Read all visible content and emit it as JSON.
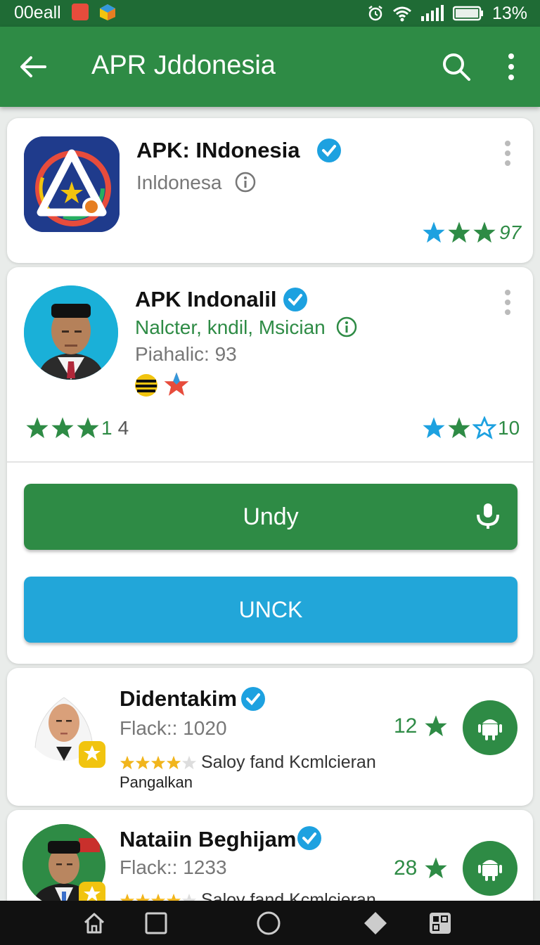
{
  "status_bar": {
    "carrier": "00eall",
    "battery": "13%",
    "icons": [
      "notification-icon",
      "app-icon",
      "alarm-icon",
      "wifi-icon",
      "signal-icon",
      "battery-icon"
    ]
  },
  "app_bar": {
    "title": "APR Jddonesia",
    "icons": [
      "back-arrow-icon",
      "search-icon",
      "more-vert-icon"
    ]
  },
  "cards": [
    {
      "name": "APK: INdonesia",
      "subtitle": "Inldonesa",
      "rating_value": "97",
      "stars_filled": 3
    },
    {
      "name": "APK Indonalil",
      "subtitle": "Nalcter, kndil, Msician",
      "detail": "Piahalic: 93",
      "rating_left": {
        "stars": 3,
        "value": "1",
        "count": "4"
      },
      "rating_right": {
        "stars_filled": 2,
        "stars_empty": 1,
        "value": "10"
      },
      "primary_button": "Undy",
      "secondary_button": "UNCK"
    },
    {
      "name": "Didentakim",
      "detail": "Flack:: 1020",
      "count": "12",
      "small_rating": "Saloy fand Kcmlcieran",
      "small_stars_filled": 4,
      "tag": "Pangalkan"
    },
    {
      "name": "Nataiin Beghijam",
      "detail": "Flack:: 1233",
      "count": "28",
      "small_rating": "Saloy fand Kcmlcieran",
      "small_stars_filled": 4
    }
  ],
  "colors": {
    "primary_green": "#2e8b45",
    "status_green": "#1f6b35",
    "accent_blue": "#22a6d9",
    "verified_blue": "#1da1e0"
  },
  "nav_bar": {
    "icons": [
      "home-icon",
      "recents-square-icon",
      "home-circle-icon",
      "back-diamond-icon",
      "apps-icon"
    ]
  }
}
